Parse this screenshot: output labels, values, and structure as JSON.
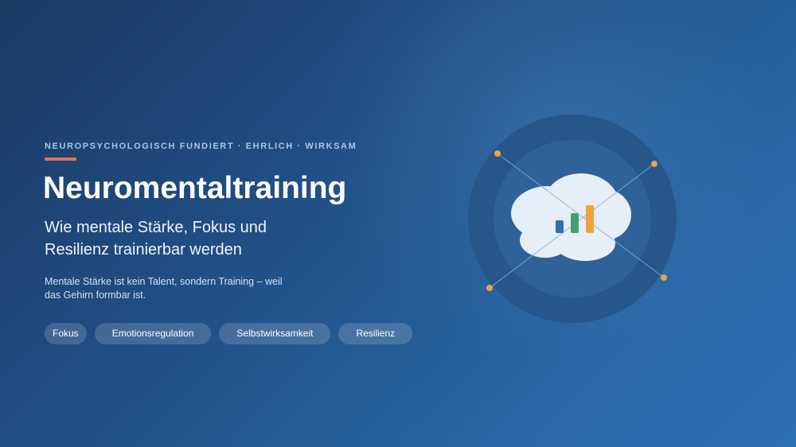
{
  "hero": {
    "eyebrow": "NEUROPSYCHOLOGISCH FUNDIERT · EHRLICH · WIRKSAM",
    "title": "Neuromentaltraining",
    "subtitle": "Wie mentale Stärke, Fokus und Resilienz trainierbar werden",
    "description": "Mentale Stärke ist kein Talent, sondern Training – weil das Gehirn formbar ist.",
    "tags": [
      "Fokus",
      "Emotionsregulation",
      "Selbstwirksamkeit",
      "Resilienz"
    ]
  },
  "colors": {
    "accent_line": "#e0715f",
    "node_dot": "#e8a84a",
    "bar_blue": "#2f6eb0",
    "bar_green": "#4a9e6e",
    "bar_orange": "#f0a23a",
    "cloud": "#e6eef7"
  },
  "illustration": {
    "type": "brain-cloud-with-growth-bars-icon",
    "bars_relative_levels": [
      0.45,
      0.7,
      1.0
    ]
  }
}
